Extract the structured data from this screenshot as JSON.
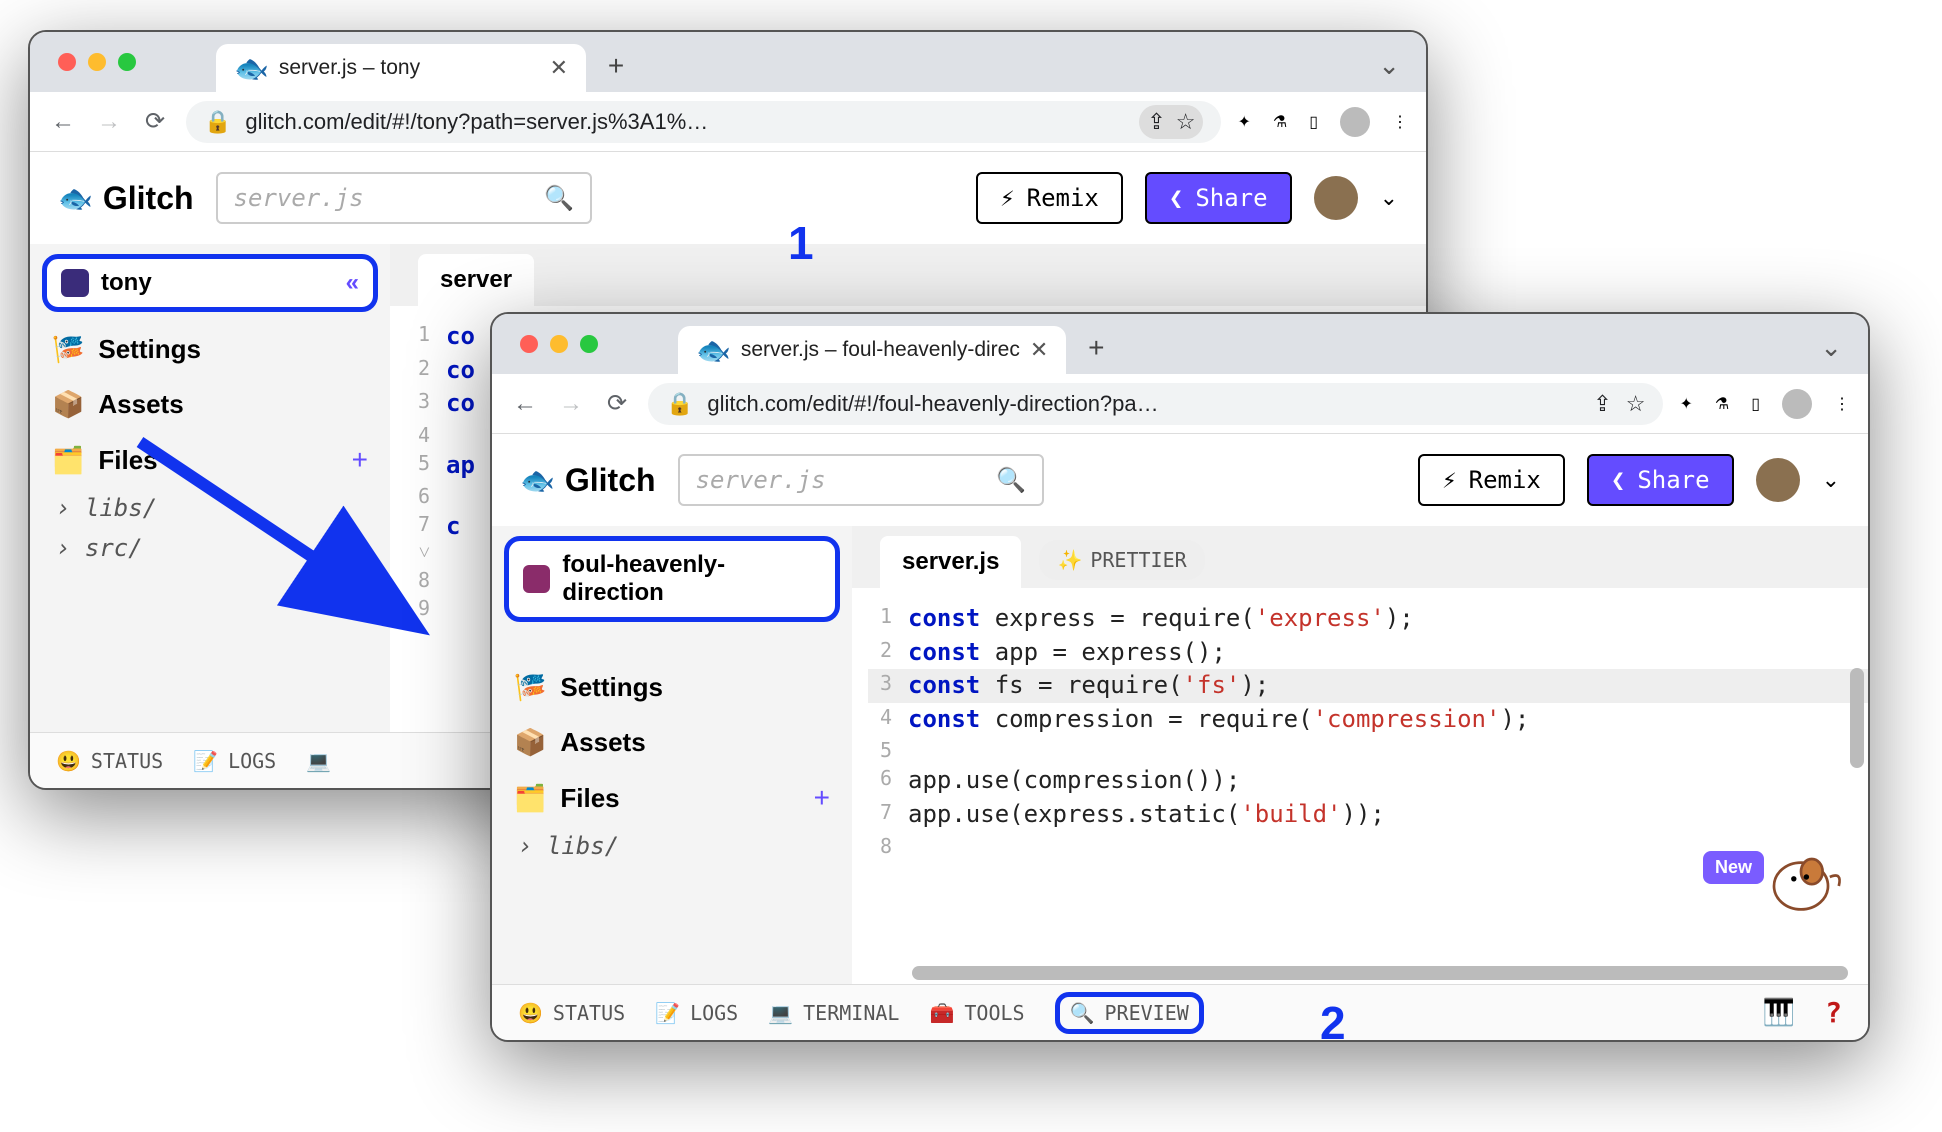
{
  "window1": {
    "tab_title": "server.js – tony",
    "url": "glitch.com/edit/#!/tony?path=server.js%3A1%…",
    "search_placeholder": "server.js",
    "remix_label": "Remix",
    "share_label": "Share",
    "project_name": "tony",
    "sidebar": {
      "settings": "Settings",
      "assets": "Assets",
      "files": "Files",
      "folders": [
        "libs/",
        "src/"
      ]
    },
    "editor_tab": "server",
    "code": [
      {
        "n": "1",
        "t": "co"
      },
      {
        "n": "2",
        "t": "co"
      },
      {
        "n": "3",
        "t": "co"
      },
      {
        "n": "4",
        "t": ""
      },
      {
        "n": "5",
        "t": "ap"
      },
      {
        "n": "6",
        "t": ""
      },
      {
        "n": "7 ˅",
        "t": "c"
      },
      {
        "n": "8",
        "t": ""
      },
      {
        "n": "9",
        "t": ""
      }
    ],
    "bottom": {
      "status": "STATUS",
      "logs": "LOGS"
    }
  },
  "window2": {
    "tab_title": "server.js – foul-heavenly-direc",
    "url": "glitch.com/edit/#!/foul-heavenly-direction?pa…",
    "search_placeholder": "server.js",
    "remix_label": "Remix",
    "share_label": "Share",
    "project_name": "foul-heavenly-direction",
    "sidebar": {
      "settings": "Settings",
      "assets": "Assets",
      "files": "Files",
      "folders": [
        "libs/"
      ]
    },
    "editor_tab": "server.js",
    "prettier_label": "PRETTIER",
    "code_lines": [
      {
        "n": 1,
        "tokens": [
          [
            "kw",
            "const"
          ],
          [
            "fn",
            " express = require("
          ],
          [
            "str",
            "'express'"
          ],
          [
            "fn",
            ");"
          ]
        ]
      },
      {
        "n": 2,
        "tokens": [
          [
            "kw",
            "const"
          ],
          [
            "fn",
            " app = express();"
          ]
        ]
      },
      {
        "n": 3,
        "hl": true,
        "tokens": [
          [
            "kw",
            "const"
          ],
          [
            "fn",
            " fs = require("
          ],
          [
            "str",
            "'fs'"
          ],
          [
            "fn",
            ");"
          ]
        ]
      },
      {
        "n": 4,
        "tokens": [
          [
            "kw",
            "const"
          ],
          [
            "fn",
            " compression = require("
          ],
          [
            "str",
            "'compression'"
          ],
          [
            "fn",
            ");"
          ]
        ]
      },
      {
        "n": 5,
        "tokens": [
          [
            "fn",
            ""
          ]
        ]
      },
      {
        "n": 6,
        "tokens": [
          [
            "fn",
            "app.use(compression());"
          ]
        ]
      },
      {
        "n": 7,
        "tokens": [
          [
            "fn",
            "app.use(express.static("
          ],
          [
            "str",
            "'build'"
          ],
          [
            "fn",
            "));"
          ]
        ]
      },
      {
        "n": 8,
        "tokens": [
          [
            "fn",
            ""
          ]
        ]
      }
    ],
    "bottom": {
      "status": "STATUS",
      "logs": "LOGS",
      "terminal": "TERMINAL",
      "tools": "TOOLS",
      "preview": "PREVIEW"
    },
    "new_badge": "New"
  },
  "annotations": {
    "callout1": "1",
    "callout2": "2"
  }
}
